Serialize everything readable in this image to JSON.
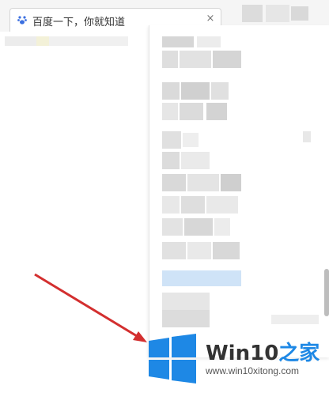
{
  "browser": {
    "tab": {
      "title": "百度一下，你就知道",
      "close_glyph": "×",
      "favicon": "baidu-paw-icon"
    }
  },
  "dropdown": {
    "note": "",
    "item_count": 9
  },
  "watermark": {
    "brand_prefix": "Win10",
    "brand_suffix": "之家",
    "url": "www.win10xitong.com"
  },
  "colors": {
    "arrow": "#d32f2f",
    "windows_blue": "#1e88e5",
    "highlight": "#cfe3f7"
  }
}
